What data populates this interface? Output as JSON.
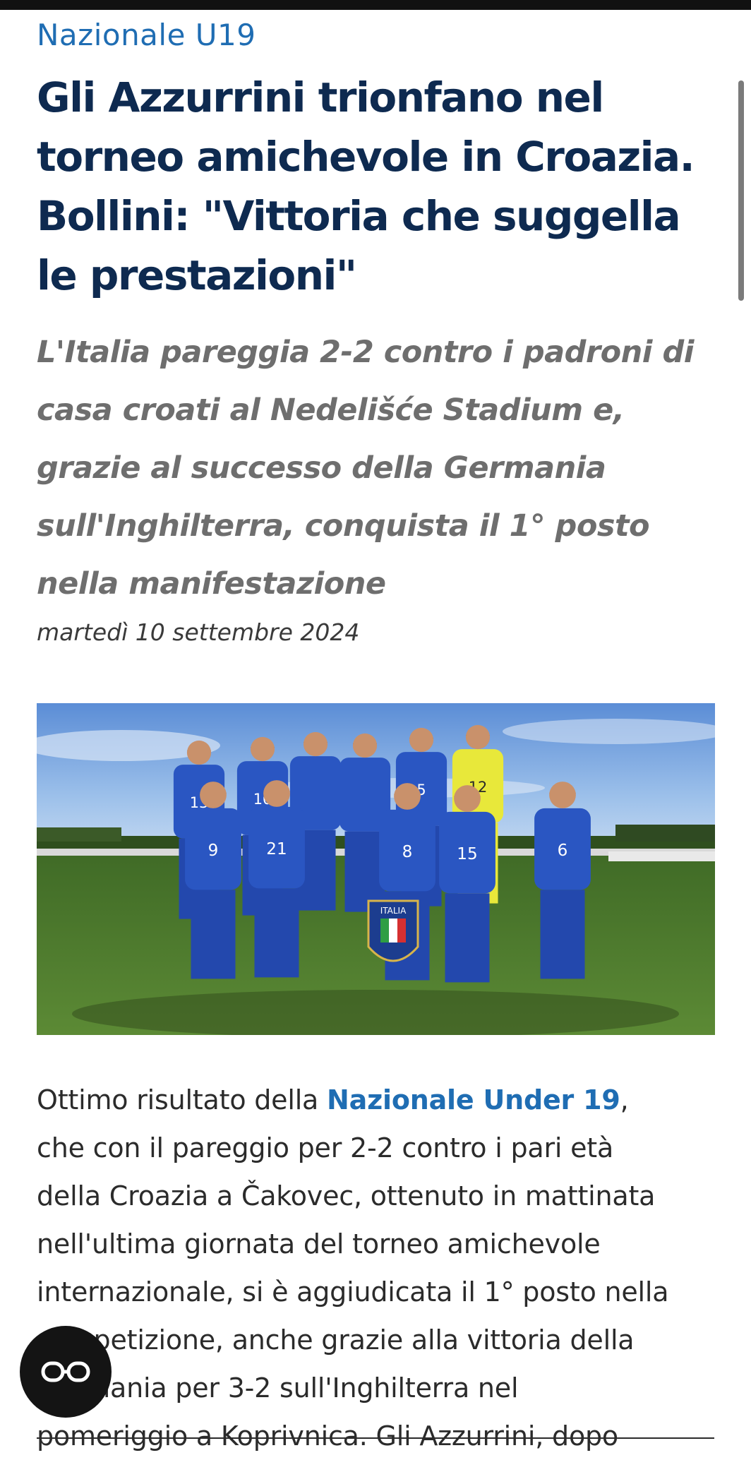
{
  "article": {
    "category": "Nazionale U19",
    "title": "Gli Azzurrini trionfano nel torneo amichevole in Croazia. Bollini: \"Vittoria che suggella le prestazioni\"",
    "subtitle": "L'Italia pareggia 2-2 contro i padroni di casa croati al Nedelišće Stadium e, grazie al successo della Germania sull'Inghilterra, conquista il 1° posto nella manifestazione",
    "date": "martedì 10 settembre 2024",
    "photo": {
      "shirt_numbers": [
        "13",
        "12",
        "9",
        "21",
        "8",
        "15",
        "6",
        "10",
        "5"
      ],
      "pennant_text": "ITALIA"
    },
    "body": {
      "intro": "Ottimo risultato della ",
      "link": "Nazionale Under 19",
      "line1_end": ",",
      "line2": "che con il pareggio per 2-2 contro i pari età",
      "line3": "della Croazia a Čakovec, ottenuto in mattinata",
      "line4": "nell'ultima giornata del torneo amichevole",
      "line5": "internazionale, si è aggiudicata il 1° posto nella",
      "line6": "competizione, anche grazie alla vittoria della",
      "line7": "Germania per 3-2 sull'Inghilterra nel",
      "line8": "pomeriggio a Koprivnica. Gli Azzurrini, dopo"
    }
  },
  "reader_button": {
    "icon": "glasses-icon"
  },
  "colors": {
    "accent": "#1f6db3",
    "title": "#0e2a50",
    "subtitle": "#6e6e6e",
    "jersey": "#2a56c2",
    "grass": "#4e7a2e"
  }
}
